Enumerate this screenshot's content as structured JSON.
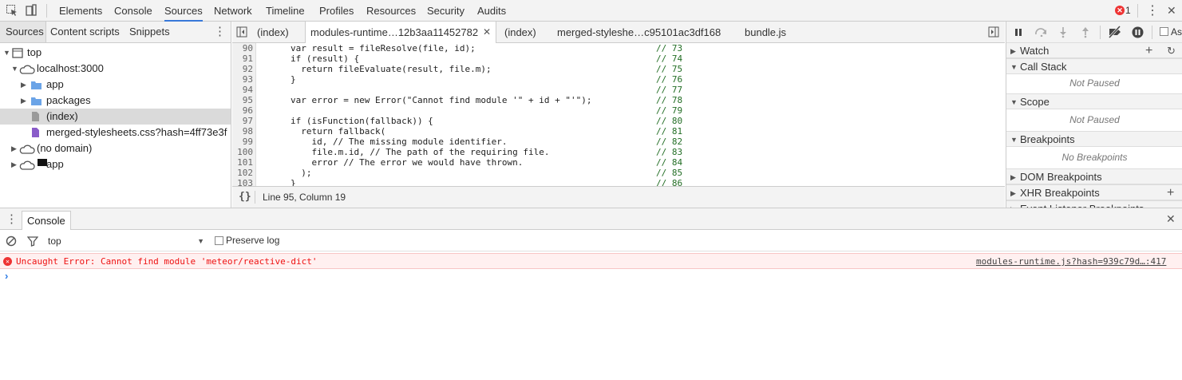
{
  "main_tabs": [
    "Elements",
    "Console",
    "Sources",
    "Network",
    "Timeline",
    "Profiles",
    "Resources",
    "Security",
    "Audits"
  ],
  "active_main_tab": "Sources",
  "error_count": "1",
  "navigator": {
    "tabs": [
      "Sources",
      "Content scripts",
      "Snippets"
    ],
    "tree": [
      {
        "label": "top",
        "icon": "frame-icon",
        "arrow": "▼"
      },
      {
        "label": "localhost:3000",
        "icon": "cloud-icon",
        "arrow": "▼"
      },
      {
        "label": "app",
        "icon": "folder-icon",
        "arrow": "▶"
      },
      {
        "label": "packages",
        "icon": "folder-icon",
        "arrow": "▶"
      },
      {
        "label": "(index)",
        "icon": "file-icon",
        "arrow": ""
      },
      {
        "label": "merged-stylesheets.css?hash=4ff73e3f",
        "icon": "css-file-icon",
        "arrow": ""
      },
      {
        "label": "(no domain)",
        "icon": "cloud-icon",
        "arrow": "▶"
      },
      {
        "label": "app",
        "icon": "cloud-icon",
        "arrow": "▶"
      }
    ]
  },
  "editor": {
    "tabs": [
      "(index)",
      "modules-runtime…12b3aa11452782",
      "(index)",
      "merged-styleshe…c95101ac3df168",
      "bundle.js"
    ],
    "status": "Line 95, Column 19",
    "format_label": "{}",
    "lines": [
      {
        "n": "90",
        "code": "var result = fileResolve(file, id);",
        "ref": "// 73"
      },
      {
        "n": "91",
        "code": "if (result) {",
        "ref": "// 74"
      },
      {
        "n": "92",
        "code": "  return fileEvaluate(result, file.m);",
        "ref": "// 75"
      },
      {
        "n": "93",
        "code": "}",
        "ref": "// 76"
      },
      {
        "n": "94",
        "code": "",
        "ref": "// 77"
      },
      {
        "n": "95",
        "code": "var error = new Error(\"Cannot find module '\" + id + \"'\");",
        "ref": "// 78"
      },
      {
        "n": "96",
        "code": "",
        "ref": "// 79"
      },
      {
        "n": "97",
        "code": "if (isFunction(fallback)) {",
        "ref": "// 80"
      },
      {
        "n": "98",
        "code": "  return fallback(",
        "ref": "// 81"
      },
      {
        "n": "99",
        "code": "    id, // The missing module identifier.",
        "ref": "// 82"
      },
      {
        "n": "100",
        "code": "    file.m.id, // The path of the requiring file.",
        "ref": "// 83"
      },
      {
        "n": "101",
        "code": "    error // The error we would have thrown.",
        "ref": "// 84"
      },
      {
        "n": "102",
        "code": "  );",
        "ref": "// 85"
      },
      {
        "n": "103",
        "code": "}",
        "ref": "// 86"
      }
    ]
  },
  "sidebar": {
    "async_label": "As",
    "panes": [
      {
        "title": "Watch",
        "arrow": "▶",
        "empty": ""
      },
      {
        "title": "Call Stack",
        "arrow": "▼",
        "empty": "Not Paused"
      },
      {
        "title": "Scope",
        "arrow": "▼",
        "empty": "Not Paused"
      },
      {
        "title": "Breakpoints",
        "arrow": "▼",
        "empty": "No Breakpoints"
      },
      {
        "title": "DOM Breakpoints",
        "arrow": "▶",
        "empty": ""
      },
      {
        "title": "XHR Breakpoints",
        "arrow": "▶",
        "empty": ""
      },
      {
        "title": "Event Listener Breakpoints",
        "arrow": "▶",
        "empty": ""
      }
    ]
  },
  "drawer": {
    "tab": "Console",
    "context": "top",
    "preserve_log": "Preserve log",
    "error_message": "Uncaught Error: Cannot find module 'meteor/reactive-dict'",
    "error_source": "modules-runtime.js?hash=939c79d…:417"
  },
  "colors": {
    "accent": "#3879d9",
    "error": "#ee1111",
    "folder": "#6ba4e7",
    "css_file": "#8a5cc9"
  }
}
